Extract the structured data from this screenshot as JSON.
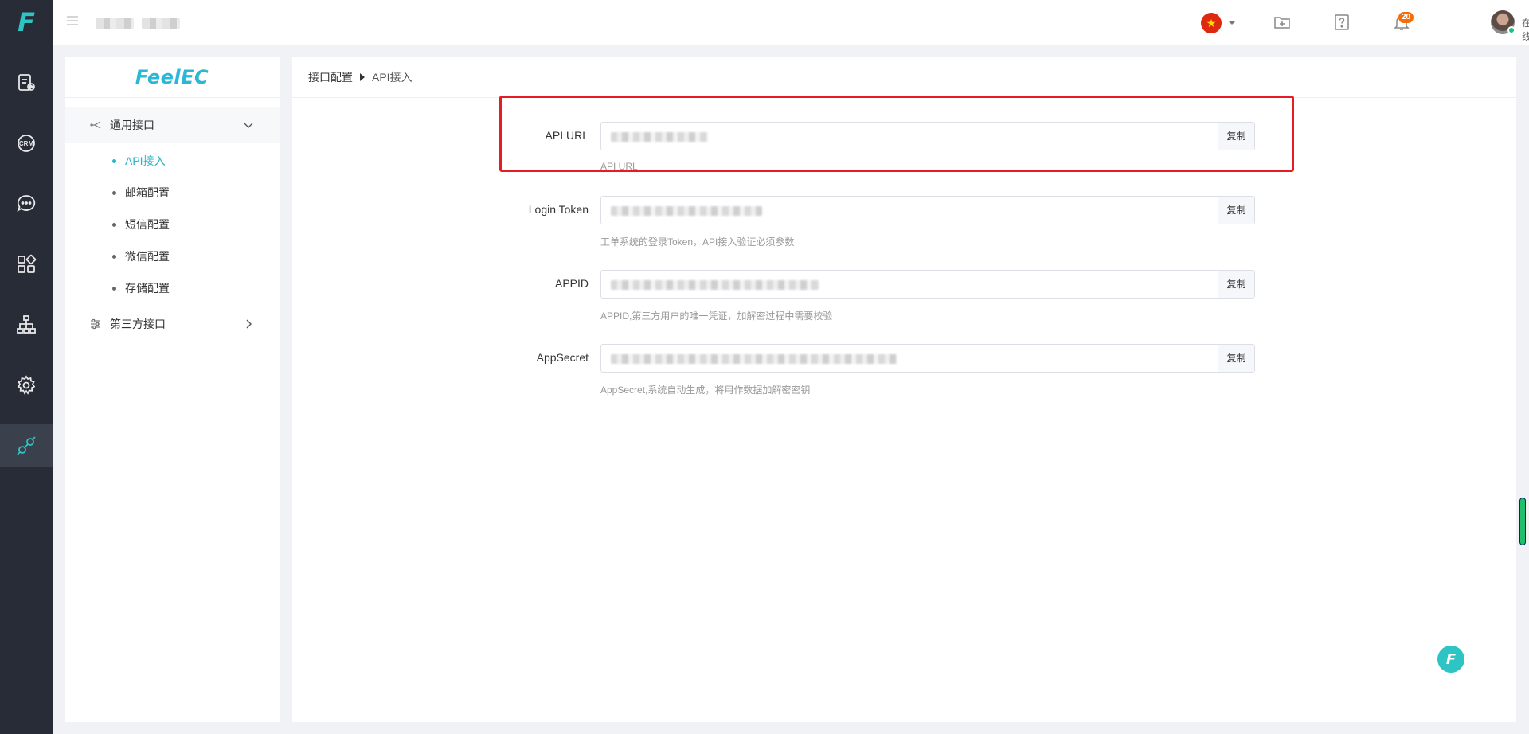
{
  "app": {
    "logo_text": "F",
    "brand_text": "FeelEC"
  },
  "rail": {
    "items": [
      {
        "name": "ticket-icon"
      },
      {
        "name": "crm-icon",
        "text": "CRM"
      },
      {
        "name": "chat-icon"
      },
      {
        "name": "apps-icon"
      },
      {
        "name": "org-chart-icon"
      },
      {
        "name": "gear-icon"
      },
      {
        "name": "api-link-icon",
        "active": true
      }
    ]
  },
  "header": {
    "notification_count": "20",
    "user_status": "在线",
    "language_flag": "★"
  },
  "sidebar": {
    "groups": [
      {
        "label": "通用接口",
        "expanded": true
      },
      {
        "label": "第三方接口",
        "expanded": false
      }
    ],
    "sub_items": [
      {
        "label": "API接入",
        "active": true
      },
      {
        "label": "邮箱配置"
      },
      {
        "label": "短信配置"
      },
      {
        "label": "微信配置"
      },
      {
        "label": "存储配置"
      }
    ]
  },
  "breadcrumb": {
    "parent": "接口配置",
    "current": "API接入"
  },
  "form": {
    "copy_label": "复制",
    "fields": [
      {
        "label": "API URL",
        "hint": "API URL"
      },
      {
        "label": "Login Token",
        "hint": "工单系统的登录Token，API接入验证必须参数"
      },
      {
        "label": "APPID",
        "hint": "APPID,第三方用户的唯一凭证，加解密过程中需要校验"
      },
      {
        "label": "AppSecret",
        "hint": "AppSecret,系统自动生成，将用作数据加解密密钥"
      }
    ]
  },
  "colors": {
    "accent": "#26b6c6",
    "rail_bg": "#272c36",
    "highlight": "#e51c23"
  },
  "float_button_text": "F"
}
